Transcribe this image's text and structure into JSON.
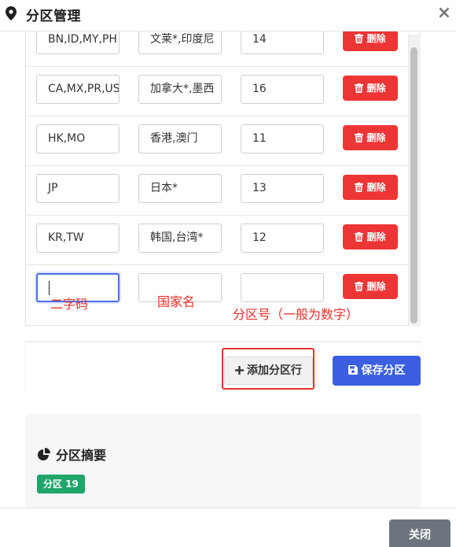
{
  "header": {
    "title": "分区管理",
    "icons": {
      "pin": "map-marker-icon",
      "close": "close-icon"
    },
    "close_glyph": "×"
  },
  "rows": [
    {
      "codes": "BN,ID,MY,PH",
      "names": "文莱*,印度尼",
      "zone": "14",
      "delete_label": "删除"
    },
    {
      "codes": "CA,MX,PR,US",
      "names": "加拿大*,墨西",
      "zone": "16",
      "delete_label": "删除"
    },
    {
      "codes": "HK,MO",
      "names": "香港,澳门",
      "zone": "11",
      "delete_label": "删除"
    },
    {
      "codes": "JP",
      "names": "日本*",
      "zone": "13",
      "delete_label": "删除"
    },
    {
      "codes": "KR,TW",
      "names": "韩国,台湾*",
      "zone": "12",
      "delete_label": "删除"
    },
    {
      "codes": "",
      "names": "",
      "zone": "",
      "delete_label": "删除"
    }
  ],
  "annotations": {
    "code_hint": "二字码",
    "name_hint": "国家名",
    "zone_hint": "分区号（一般为数字）"
  },
  "actions": {
    "add_row": "添加分区行",
    "save": "保存分区"
  },
  "summary": {
    "title": "分区摘要",
    "badge": "分区 19"
  },
  "footer": {
    "close": "关闭"
  },
  "colors": {
    "danger": "#ee3535",
    "primary": "#3b5fe0",
    "success": "#1fa56a",
    "annotation": "#e8302a",
    "secondary": "#6c757d"
  }
}
